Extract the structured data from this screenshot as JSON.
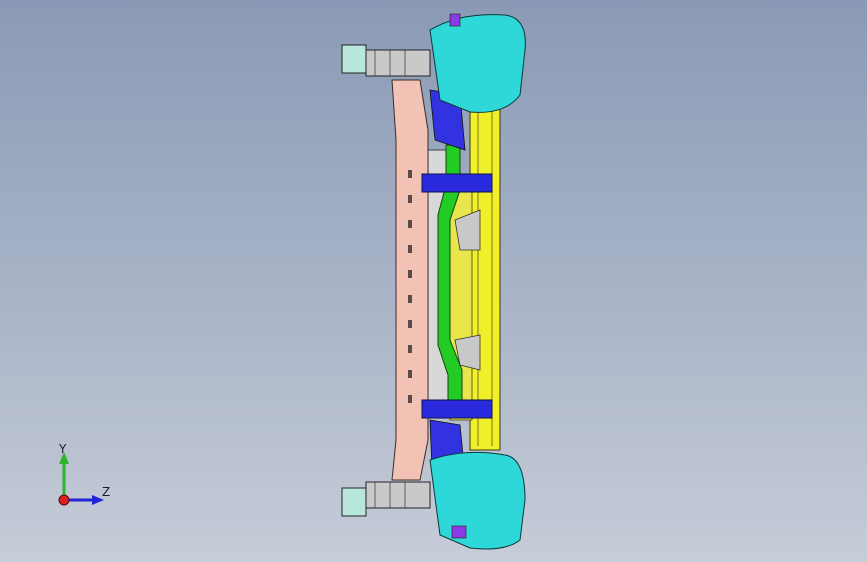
{
  "viewport": {
    "background_top": "#8a9ab6",
    "background_bottom": "#c6ccd8"
  },
  "model": {
    "description_parts": [
      "bumper-beam",
      "cross-member",
      "crash-box-upper",
      "crash-box-lower",
      "mounting-bracket",
      "support-frame"
    ],
    "colors": {
      "beam": "#f2c2b4",
      "frame": "#f0ef2a",
      "crossmember": "#22cc22",
      "clamp": "#2a2adf",
      "crashbox": "#2fd8d8",
      "bracket": "#b9b9b9",
      "accent_purple": "#8a3ae6"
    }
  },
  "triad": {
    "y_label": "Y",
    "z_label": "Z",
    "y_color": "#2ab52a",
    "z_color": "#2323d9",
    "x_color": "#d92323"
  }
}
